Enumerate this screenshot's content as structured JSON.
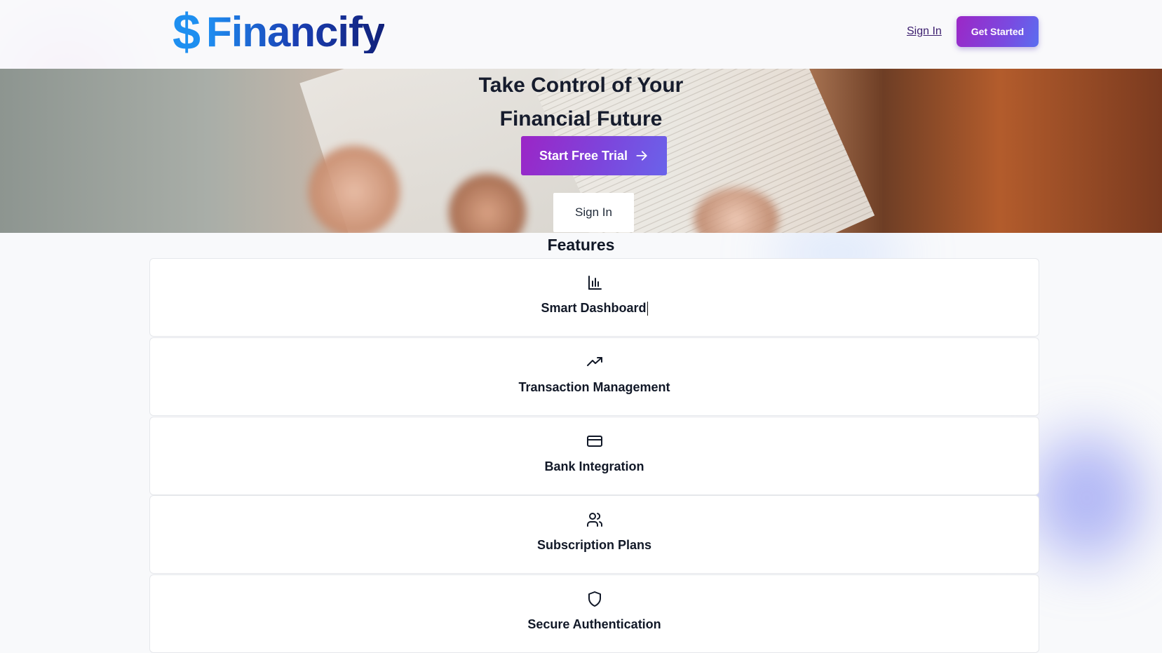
{
  "header": {
    "logo_symbol": "$",
    "logo_text": "Financify",
    "signin_label": "Sign In",
    "get_started_label": "Get Started"
  },
  "hero": {
    "title_line1": "Take Control of Your",
    "title_line2": "Financial Future",
    "cta_label": "Start Free Trial",
    "signin_label": "Sign In"
  },
  "features": {
    "title": "Features",
    "items": [
      {
        "label": "Smart Dashboard",
        "icon": "bar-chart-icon"
      },
      {
        "label": "Transaction Management",
        "icon": "trending-up-icon"
      },
      {
        "label": "Bank Integration",
        "icon": "credit-card-icon"
      },
      {
        "label": "Subscription Plans",
        "icon": "users-icon"
      },
      {
        "label": "Secure Authentication",
        "icon": "shield-icon"
      }
    ]
  },
  "colors": {
    "accent_purple": "#9b25c6",
    "accent_blue": "#5b6ef0",
    "logo_blue": "#1e8ff0",
    "text_dark": "#111827"
  }
}
